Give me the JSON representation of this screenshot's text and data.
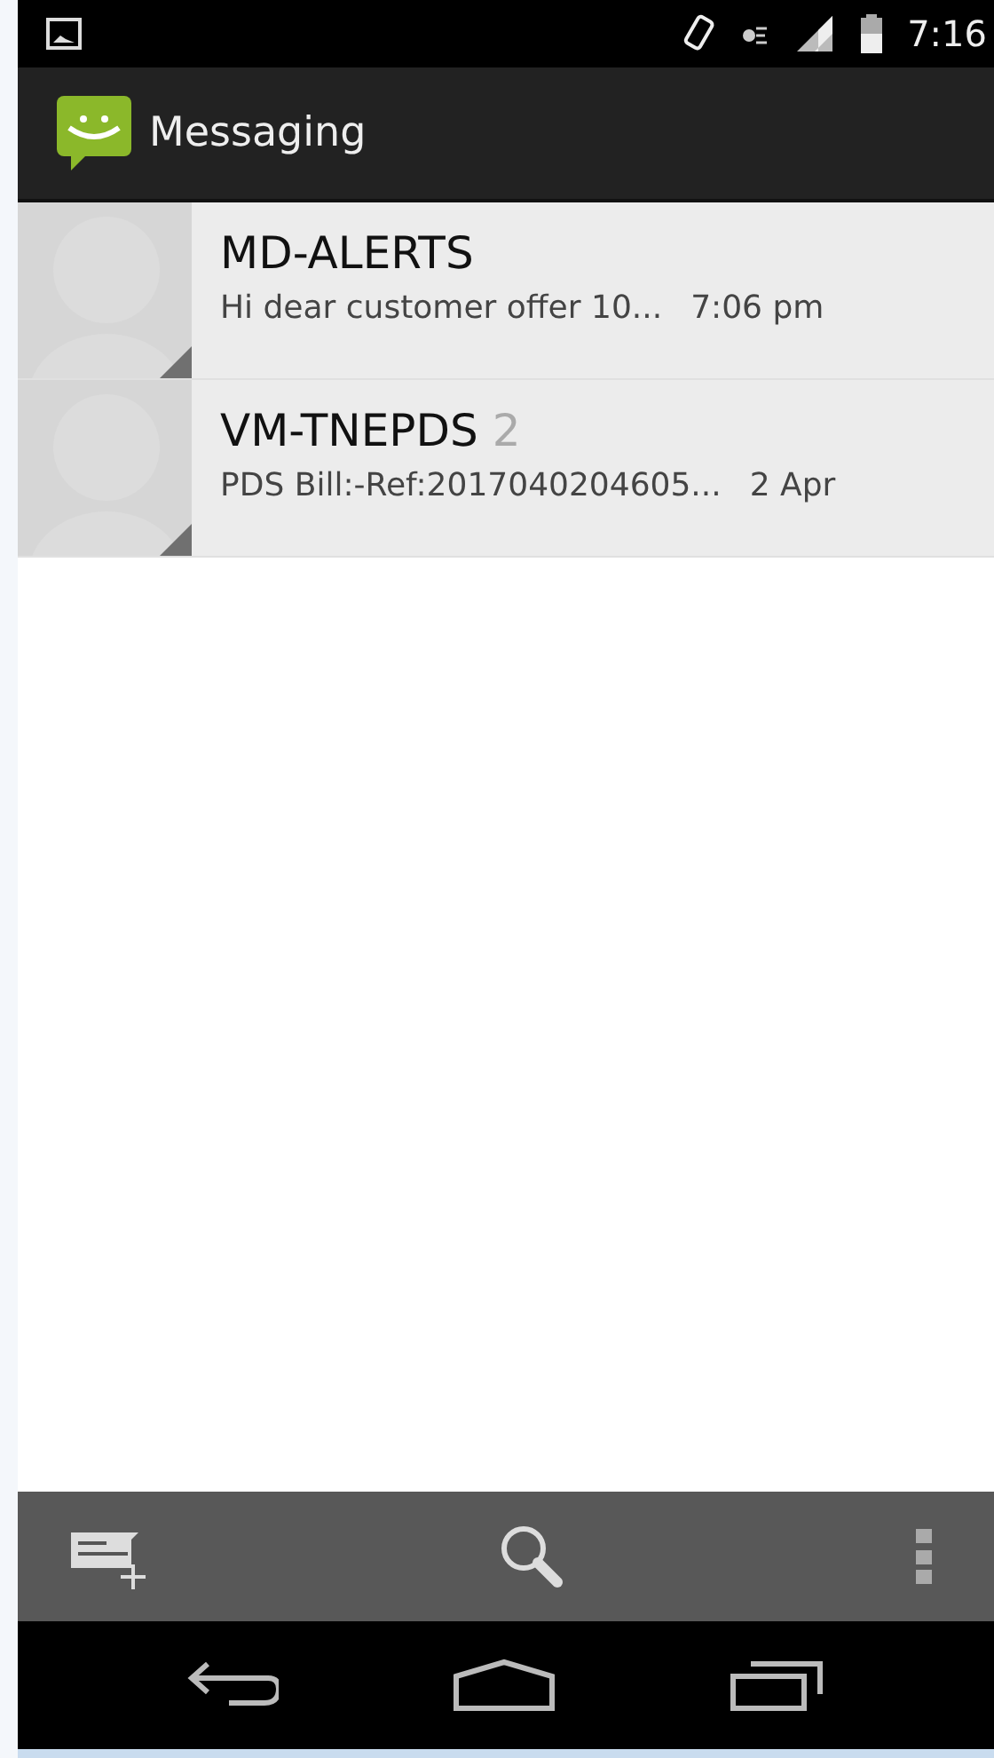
{
  "status_bar": {
    "time": "7:16"
  },
  "action_bar": {
    "title": "Messaging"
  },
  "conversations": [
    {
      "sender": "MD-ALERTS",
      "snippet": "Hi dear customer offer 10...",
      "time": "7:06 pm"
    },
    {
      "sender": "VM-TNEPDS",
      "count": "2",
      "snippet": "PDS Bill:-Ref:2017040204605...",
      "time": "2 Apr"
    }
  ]
}
